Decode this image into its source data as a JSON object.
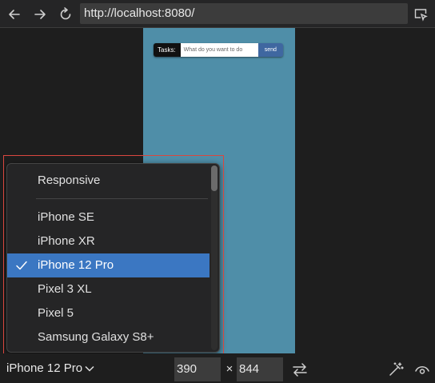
{
  "toolbar": {
    "back_icon": "arrow-left-icon",
    "forward_icon": "arrow-right-icon",
    "reload_icon": "reload-icon",
    "url": "http://localhost:8080/",
    "inspect_icon": "inspect-icon"
  },
  "preview": {
    "background_color": "#4f8ea8",
    "task_label": "Tasks:",
    "task_placeholder": "What do you want to do",
    "send_label": "send"
  },
  "device_menu": {
    "items": [
      {
        "label": "Responsive",
        "selected": false
      },
      {
        "label": "iPhone SE",
        "selected": false
      },
      {
        "label": "iPhone XR",
        "selected": false
      },
      {
        "label": "iPhone 12 Pro",
        "selected": true
      },
      {
        "label": "Pixel 3 XL",
        "selected": false
      },
      {
        "label": "Pixel 5",
        "selected": false
      },
      {
        "label": "Samsung Galaxy S8+",
        "selected": false
      }
    ],
    "selected_color": "#3b77c2"
  },
  "bottombar": {
    "device_label": "iPhone 12 Pro",
    "width": "390",
    "height": "844",
    "separator": "×",
    "rotate_icon": "swap-arrows-icon",
    "touch_icon": "magic-wand-icon",
    "preview_icon": "eye-icon"
  },
  "highlight_color": "#d9473f"
}
